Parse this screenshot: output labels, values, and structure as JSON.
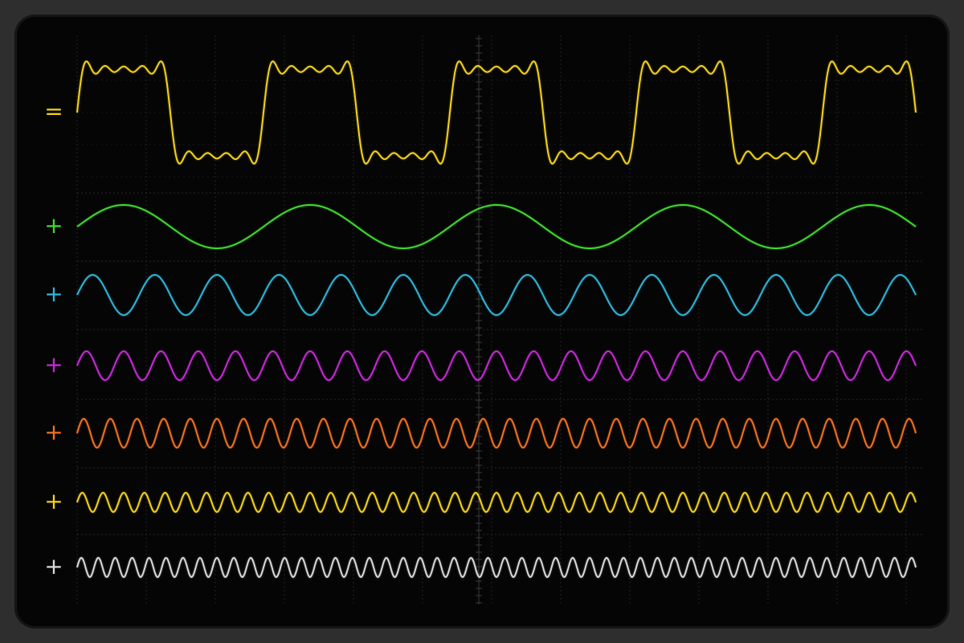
{
  "chart_data": {
    "type": "line",
    "title": "",
    "xlabel": "",
    "ylabel": "",
    "grid": true,
    "cycles_across": 4.5,
    "series": [
      {
        "symbol": "=",
        "color": "#f2d21a",
        "kind": "sum",
        "components": [
          1,
          3,
          5,
          7,
          9
        ],
        "amplitudes": [
          1,
          0.333,
          0.2,
          0.143,
          0.111
        ]
      },
      {
        "symbol": "+",
        "color": "#3ed92e",
        "harmonic": 1,
        "amplitude": 1
      },
      {
        "symbol": "+",
        "color": "#2fb4d6",
        "harmonic": 3,
        "amplitude": 1
      },
      {
        "symbol": "+",
        "color": "#c628d6",
        "harmonic": 5,
        "amplitude": 1
      },
      {
        "symbol": "+",
        "color": "#f07020",
        "harmonic": 7,
        "amplitude": 1
      },
      {
        "symbol": "+",
        "color": "#f2d21a",
        "harmonic": 9,
        "amplitude": 1
      },
      {
        "symbol": "+",
        "color": "#d8d8d8",
        "harmonic": 11,
        "amplitude": 1
      }
    ]
  }
}
